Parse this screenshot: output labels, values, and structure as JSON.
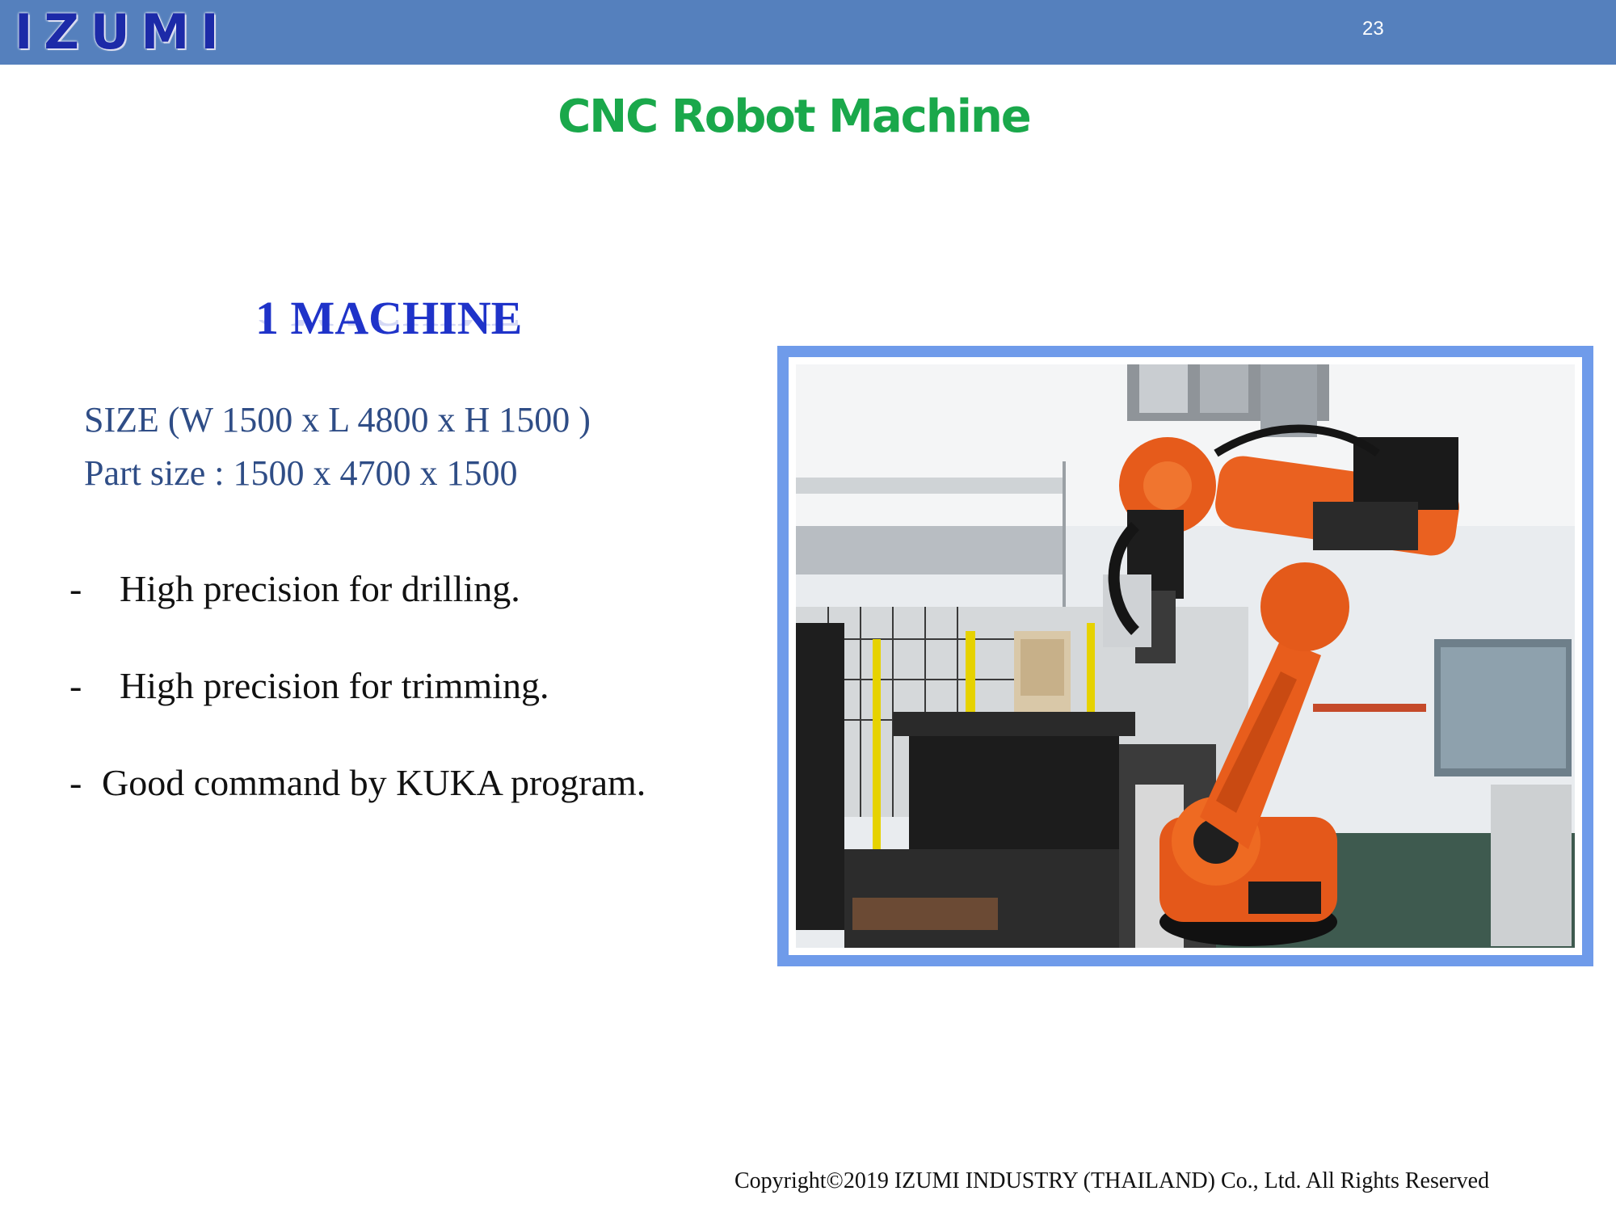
{
  "header": {
    "logo": "IZUMI",
    "page_number": "23",
    "bg_color": "#5580bd"
  },
  "slide": {
    "title": "CNC Robot Machine",
    "machine_heading": "1 MACHINE",
    "size_line": "SIZE (W 1500 x L 4800 x H 1500 )",
    "part_size_line": "Part size : 1500 x 4700 x 1500",
    "bullets": [
      {
        "dash": "-",
        "text": "High precision for drilling."
      },
      {
        "dash": "-",
        "text": "High precision for trimming."
      },
      {
        "dash": "-",
        "text": "Good command by KUKA program."
      }
    ],
    "photo_subject": "orange industrial robot arm in factory cell",
    "title_color": "#1aa84b",
    "heading_color": "#1f33c9"
  },
  "footer": {
    "copyright": "Copyright©2019 IZUMI INDUSTRY (THAILAND) Co., Ltd. All Rights Reserved"
  }
}
